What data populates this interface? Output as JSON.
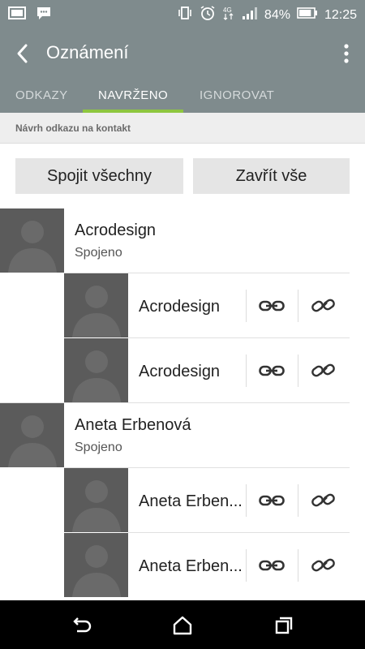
{
  "status_bar": {
    "icons_left": [
      "gallery-notification-icon",
      "message-notification-icon"
    ],
    "icons_right": [
      "vibrate-icon",
      "alarm-icon",
      "network-4g-icon",
      "signal-icon"
    ],
    "battery_percent": "84%",
    "battery_level": 0.84,
    "time": "12:25"
  },
  "app_bar": {
    "title": "Oznámení",
    "back_icon": "back-arrow-icon",
    "menu_icon": "overflow-menu-icon"
  },
  "tabs": [
    {
      "label": "ODKAZY",
      "active": false
    },
    {
      "label": "NAVRŽENO",
      "active": true
    },
    {
      "label": "IGNOROVAT",
      "active": false
    }
  ],
  "section_header": "Návrh odkazu na kontakt",
  "buttons": {
    "merge_all": "Spojit všechny",
    "close_all": "Zavřít vše"
  },
  "groups": [
    {
      "name": "Acrodesign",
      "status": "Spojeno",
      "items": [
        {
          "name": "Acrodesign"
        },
        {
          "name": "Acrodesign"
        }
      ]
    },
    {
      "name": "Aneta Erbenová",
      "status": "Spojeno",
      "items": [
        {
          "name": "Aneta Erben..."
        },
        {
          "name": "Aneta Erben..."
        }
      ]
    }
  ],
  "nav_bar": {
    "icons": [
      "back-icon",
      "home-icon",
      "recent-apps-icon"
    ]
  },
  "colors": {
    "header": "#7f8b8d",
    "tab_indicator": "#8ec63f",
    "avatar_bg": "#5b5b5b",
    "button_bg": "#e5e5e5"
  }
}
